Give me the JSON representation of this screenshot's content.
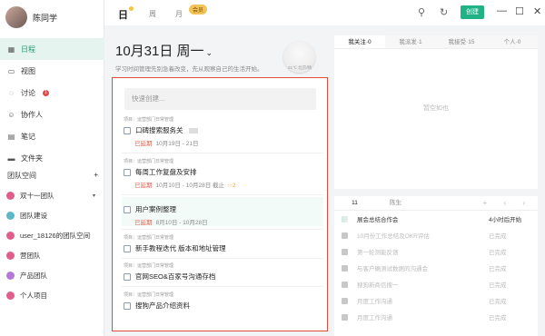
{
  "user": {
    "name": "陈同学"
  },
  "nav": [
    {
      "label": "日程",
      "icon": "calendar-icon"
    },
    {
      "label": "视图",
      "icon": "view-icon"
    },
    {
      "label": "讨论",
      "icon": "chat-icon",
      "badge": "1"
    },
    {
      "label": "协作人",
      "icon": "people-icon"
    },
    {
      "label": "笔记",
      "icon": "note-icon"
    },
    {
      "label": "文件夹",
      "icon": "folder-icon"
    }
  ],
  "team_header": {
    "label": "团队空间",
    "add": "+"
  },
  "teams": [
    {
      "label": "双十一团队",
      "color": "#e25d8a",
      "caret": "▾"
    },
    {
      "label": "团队建设",
      "color": "#5bb8c9"
    },
    {
      "label": "user_18126的团队空间",
      "color": "#e25d8a"
    },
    {
      "label": "营团队",
      "color": "#e25d8a"
    },
    {
      "label": "产品团队",
      "color": "#b57ad9"
    },
    {
      "label": "个人项目",
      "color": "#e25d8a"
    }
  ],
  "topbar": {
    "logo": "日",
    "tabs": [
      "周",
      "月"
    ],
    "vip": "会员",
    "create": "创建"
  },
  "date": {
    "title": "10月31日 周一",
    "caret": "⌄",
    "subtitle": "学习时间管理先别急着改变，先从观察自己的生活开始。",
    "weather": "21℃ 北京/晴"
  },
  "tasks": {
    "placeholder": "快速创建...",
    "items": [
      {
        "project": "项目：运营部门日常管理",
        "title": "口碑搜索服务关",
        "date_status": "已延期",
        "date_range": "10月19日 - 21日"
      },
      {
        "project": "项目：运营部门日常管理",
        "title": "每周工作复盘及安排",
        "date_status": "已延期",
        "date_range": "10月10日 - 10月28日 截止",
        "extra": "☆2"
      },
      {
        "project": "",
        "title": "用户案例整理",
        "date_status": "已延期",
        "date_range": "8月10日 - 10月28日"
      },
      {
        "project": "项目：运营部门日常管理",
        "title": "新手教程迭代 版本和地址管理",
        "date_status": "",
        "date_range": ""
      },
      {
        "project": "项目：运营部门日常管理",
        "title": "官网SEO&百家号沟通存档",
        "date_status": "",
        "date_range": ""
      },
      {
        "project": "项目：运营部门日常管理",
        "title": "搜狗产品介绍资料",
        "date_status": "",
        "date_range": ""
      }
    ]
  },
  "right_top": {
    "tabs": [
      "我关注·0",
      "我派发·1",
      "我接受·15",
      "个人·0"
    ],
    "empty": "暂空如也"
  },
  "right_bottom": {
    "tabs": [
      "11",
      "陈生"
    ],
    "icons": "+ ‹ ›",
    "rows": [
      {
        "title": "展会总结合作会",
        "status": "4小时后开始"
      },
      {
        "title": "10月份工作总结及OKR评估",
        "status": "已完成"
      },
      {
        "title": "第一轮测能反馈",
        "status": "已完成"
      },
      {
        "title": "与客户确测试数据的沟通会",
        "status": "已完成"
      },
      {
        "title": "搜狗新商信搜一",
        "status": "已完成"
      },
      {
        "title": "月度工作沟通",
        "status": "已完成"
      },
      {
        "title": "月度工作沟通",
        "status": "已完成"
      }
    ]
  }
}
